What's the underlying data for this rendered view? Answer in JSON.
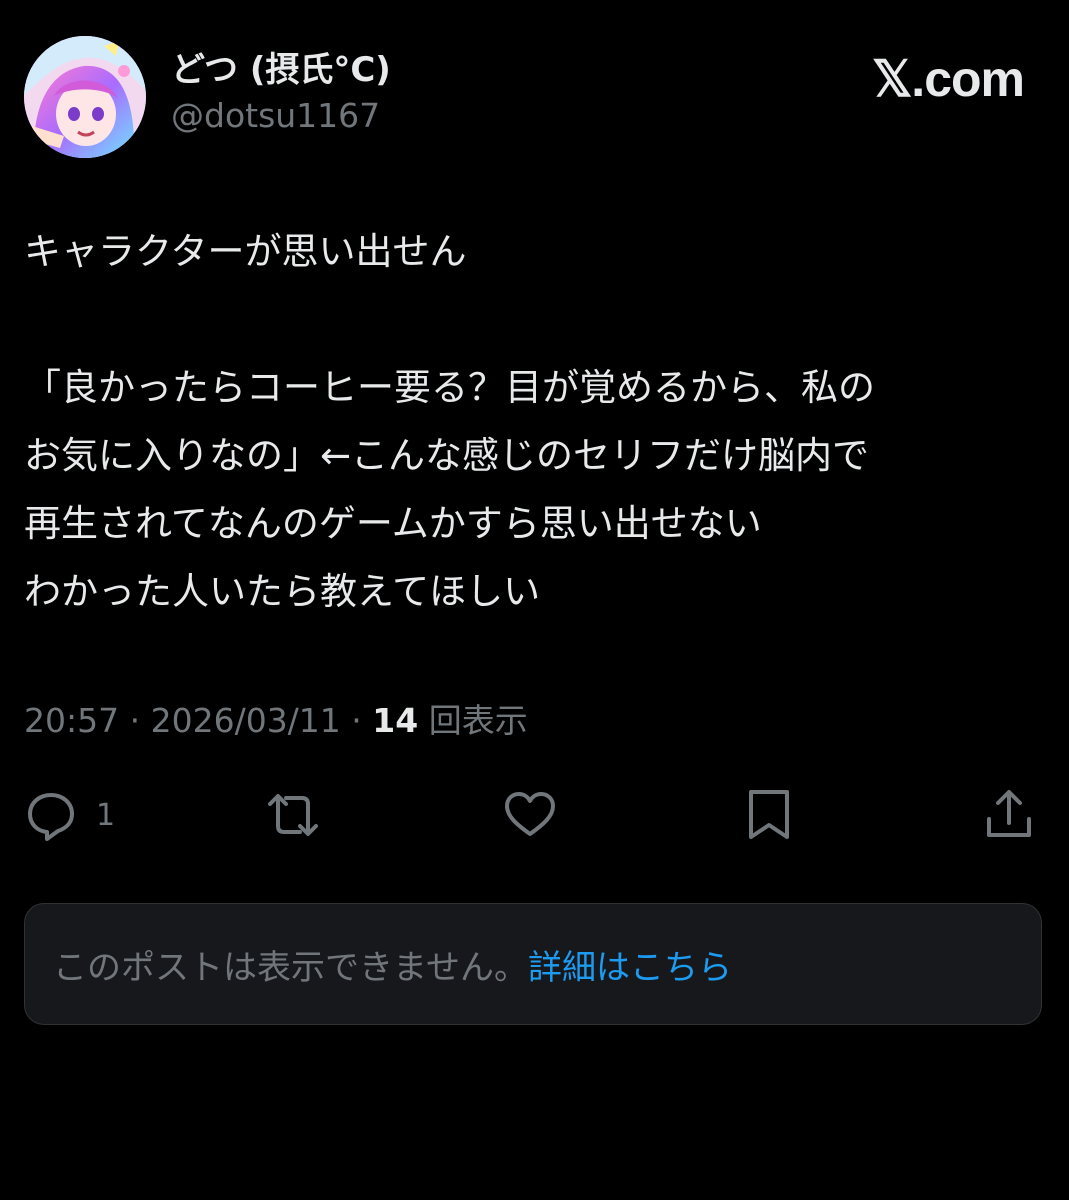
{
  "author": {
    "display_name": "どつ (摂氏°C)",
    "handle": "@dotsu1167"
  },
  "brand": {
    "label": "𝕏.com"
  },
  "post": {
    "line1": "キャラクターが思い出せん",
    "paragraph2": "「良かったらコーヒー要る？目が覚めるから、私の\nお気に入りなの」←こんな感じのセリフだけ脳内で\n再生されてなんのゲームかすら思い出せない\nわかった人いたら教えてほしい"
  },
  "meta": {
    "time": "20:57",
    "separator": " · ",
    "date": "2026/03/11",
    "views_count": "14",
    "views_label": " 回表示"
  },
  "actions": {
    "reply_count": "1",
    "icons": [
      "reply-icon",
      "repost-icon",
      "like-icon",
      "bookmark-icon",
      "share-icon"
    ]
  },
  "notice": {
    "text": "このポストは表示できません。",
    "link": "詳細はこちら"
  },
  "colors": {
    "background": "#000000",
    "primary_text": "#e7e9ea",
    "secondary_text": "#71767b",
    "link": "#1d9bf0",
    "notice_background": "#16181c"
  }
}
